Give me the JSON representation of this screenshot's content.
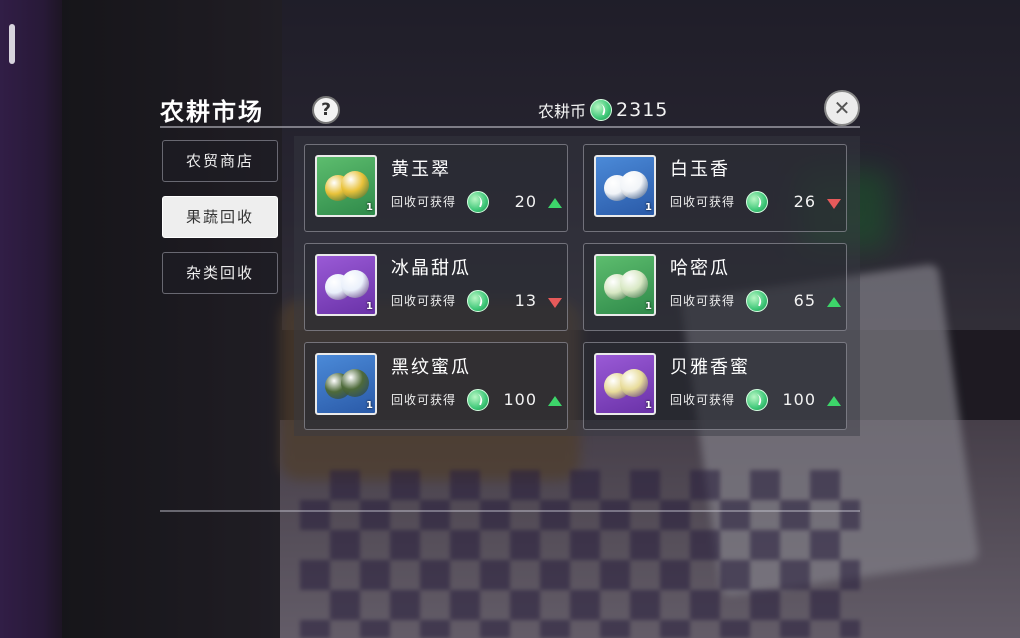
{
  "header": {
    "title": "农耕市场",
    "help_label": "?",
    "currency_label": "农耕币",
    "currency_amount": "2315",
    "close_icon": "close-icon"
  },
  "sidebar": {
    "items": [
      {
        "label": "农贸商店",
        "active": false
      },
      {
        "label": "果蔬回收",
        "active": true
      },
      {
        "label": "杂类回收",
        "active": false
      }
    ]
  },
  "items": [
    {
      "name": "黄玉翠",
      "recycle_label": "回收可获得",
      "value": "20",
      "trend": "up",
      "bg": "green",
      "fruit_color": "#e9c23a",
      "badge": "1"
    },
    {
      "name": "白玉香",
      "recycle_label": "回收可获得",
      "value": "26",
      "trend": "down",
      "bg": "blue",
      "fruit_color": "#f1f4f8",
      "badge": "1"
    },
    {
      "name": "冰晶甜瓜",
      "recycle_label": "回收可获得",
      "value": "13",
      "trend": "down",
      "bg": "purple",
      "fruit_color": "#eaf0fb",
      "badge": "1"
    },
    {
      "name": "哈密瓜",
      "recycle_label": "回收可获得",
      "value": "65",
      "trend": "up",
      "bg": "green",
      "fruit_color": "#d8e8c4",
      "badge": "1"
    },
    {
      "name": "黑纹蜜瓜",
      "recycle_label": "回收可获得",
      "value": "100",
      "trend": "up",
      "bg": "blue",
      "fruit_color": "#4e6a3a",
      "badge": "1"
    },
    {
      "name": "贝雅香蜜",
      "recycle_label": "回收可获得",
      "value": "100",
      "trend": "up",
      "bg": "purple",
      "fruit_color": "#e8dc9a",
      "badge": "1"
    }
  ],
  "colors": {
    "up": "#3dd66a",
    "down": "#e65a5a",
    "coin": "#3fc879"
  }
}
